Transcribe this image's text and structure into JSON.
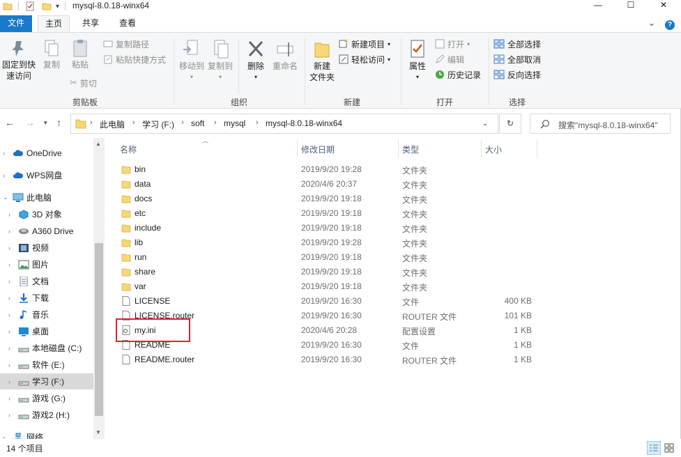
{
  "window": {
    "title": "mysql-8.0.18-winx64",
    "minimize": "—",
    "maximize": "☐",
    "close": "✕"
  },
  "tabs": {
    "file": "文件",
    "home": "主页",
    "share": "共享",
    "view": "查看",
    "expand": "⌄",
    "help": "?"
  },
  "ribbon": {
    "pin_quick_access": "固定到快\n速访问",
    "copy": "复制",
    "paste": "粘贴",
    "copy_path": "复制路径",
    "paste_shortcut": "粘贴快捷方式",
    "cut": "剪切",
    "group_clipboard": "剪贴板",
    "move_to": "移动到",
    "copy_to": "复制到",
    "delete": "删除",
    "rename": "重命名",
    "group_organize": "组织",
    "new_folder": "新建\n文件夹",
    "new_item": "新建项目",
    "easy_access": "轻松访问",
    "group_new": "新建",
    "properties": "属性",
    "open": "打开",
    "edit": "编辑",
    "history": "历史记录",
    "group_open": "打开",
    "select_all": "全部选择",
    "select_none": "全部取消",
    "invert_selection": "反向选择",
    "group_select": "选择"
  },
  "address": {
    "crumbs": [
      "此电脑",
      "学习 (F:)",
      "soft",
      "mysql",
      "mysql-8.0.18-winx64"
    ],
    "search_placeholder": "搜索\"mysql-8.0.18-winx64\""
  },
  "nav": {
    "items": [
      {
        "label": "OneDrive",
        "icon": "cloud-icon",
        "indent": 0
      },
      {
        "label": "WPS网盘",
        "icon": "cloud-icon",
        "indent": 0
      },
      {
        "label": "此电脑",
        "icon": "computer-icon",
        "indent": 0,
        "expanded": true
      },
      {
        "label": "3D 对象",
        "icon": "cube-icon",
        "indent": 1
      },
      {
        "label": "A360 Drive",
        "icon": "drive-icon",
        "indent": 1
      },
      {
        "label": "视频",
        "icon": "video-icon",
        "indent": 1
      },
      {
        "label": "图片",
        "icon": "picture-icon",
        "indent": 1
      },
      {
        "label": "文档",
        "icon": "document-icon",
        "indent": 1
      },
      {
        "label": "下载",
        "icon": "download-icon",
        "indent": 1
      },
      {
        "label": "音乐",
        "icon": "music-icon",
        "indent": 1
      },
      {
        "label": "桌面",
        "icon": "desktop-icon",
        "indent": 1
      },
      {
        "label": "本地磁盘 (C:)",
        "icon": "disk-icon",
        "indent": 1
      },
      {
        "label": "软件 (E:)",
        "icon": "disk-icon",
        "indent": 1
      },
      {
        "label": "学习 (F:)",
        "icon": "disk-icon",
        "indent": 1,
        "selected": true
      },
      {
        "label": "游戏 (G:)",
        "icon": "disk-icon",
        "indent": 1
      },
      {
        "label": "游戏2 (H:)",
        "icon": "disk-icon",
        "indent": 1
      },
      {
        "label": "网络",
        "icon": "network-icon",
        "indent": 0
      }
    ]
  },
  "columns": {
    "name": "名称",
    "modified": "修改日期",
    "type": "类型",
    "size": "大小"
  },
  "files": [
    {
      "name": "bin",
      "modified": "2019/9/20 19:28",
      "type": "文件夹",
      "size": "",
      "kind": "folder"
    },
    {
      "name": "data",
      "modified": "2020/4/6 20:37",
      "type": "文件夹",
      "size": "",
      "kind": "folder"
    },
    {
      "name": "docs",
      "modified": "2019/9/20 19:18",
      "type": "文件夹",
      "size": "",
      "kind": "folder"
    },
    {
      "name": "etc",
      "modified": "2019/9/20 19:18",
      "type": "文件夹",
      "size": "",
      "kind": "folder"
    },
    {
      "name": "include",
      "modified": "2019/9/20 19:18",
      "type": "文件夹",
      "size": "",
      "kind": "folder"
    },
    {
      "name": "lib",
      "modified": "2019/9/20 19:28",
      "type": "文件夹",
      "size": "",
      "kind": "folder"
    },
    {
      "name": "run",
      "modified": "2019/9/20 19:18",
      "type": "文件夹",
      "size": "",
      "kind": "folder"
    },
    {
      "name": "share",
      "modified": "2019/9/20 19:18",
      "type": "文件夹",
      "size": "",
      "kind": "folder"
    },
    {
      "name": "var",
      "modified": "2019/9/20 19:18",
      "type": "文件夹",
      "size": "",
      "kind": "folder"
    },
    {
      "name": "LICENSE",
      "modified": "2019/9/20 16:30",
      "type": "文件",
      "size": "400 KB",
      "kind": "file"
    },
    {
      "name": "LICENSE.router",
      "modified": "2019/9/20 16:30",
      "type": "ROUTER 文件",
      "size": "101 KB",
      "kind": "file"
    },
    {
      "name": "my.ini",
      "modified": "2020/4/6 20:28",
      "type": "配置设置",
      "size": "1 KB",
      "kind": "ini"
    },
    {
      "name": "README",
      "modified": "2019/9/20 16:30",
      "type": "文件",
      "size": "1 KB",
      "kind": "file"
    },
    {
      "name": "README.router",
      "modified": "2019/9/20 16:30",
      "type": "ROUTER 文件",
      "size": "1 KB",
      "kind": "file"
    }
  ],
  "status": {
    "item_count": "14 个项目"
  },
  "colors": {
    "folder": "#f8d775",
    "accent": "#1979ca",
    "highlight_box": "#e0232e",
    "selected_nav": "#d9d9d9"
  }
}
